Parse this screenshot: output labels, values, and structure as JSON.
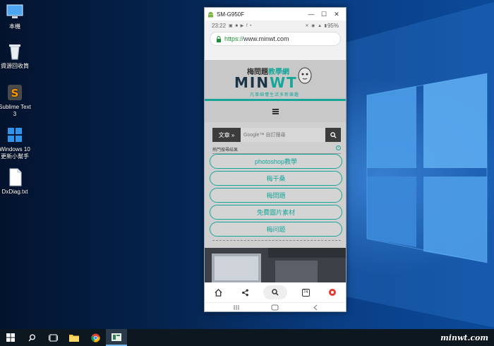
{
  "desktop": {
    "icons": [
      {
        "label": "本機"
      },
      {
        "label": "資源回收筒"
      },
      {
        "label": "Sublime Text 3"
      },
      {
        "label": "Windows 10 更新小幫手"
      },
      {
        "label": "DxDiag.txt"
      }
    ]
  },
  "window": {
    "title": "SM-G950F",
    "minimize_icon": "minimize-icon",
    "maximize_icon": "maximize-icon",
    "close_icon": "close-icon"
  },
  "phone": {
    "status": {
      "time": "23:22",
      "battery": "95%"
    },
    "url": {
      "scheme": "https://",
      "host": "www.minwt.com"
    },
    "site": {
      "logo_top_a": "梅問題",
      "logo_top_b": "教學網",
      "logo_main_a": "MIN",
      "logo_main_b": "WT",
      "logo_sub": "凡事細懂生活多新樂趣"
    },
    "search": {
      "category": "文章 »",
      "placeholder": "Google™ 自訂搜尋"
    },
    "related": {
      "heading": "熱門搜尋結果",
      "items": [
        "photoshop教學",
        "梅干桑",
        "梅問題",
        "免費圖片素材",
        "梅问题"
      ]
    },
    "toolbar": {
      "tab_count": "74"
    }
  },
  "taskbar": {
    "watermark": "minwt.com",
    "accent": "#76b9ed"
  }
}
